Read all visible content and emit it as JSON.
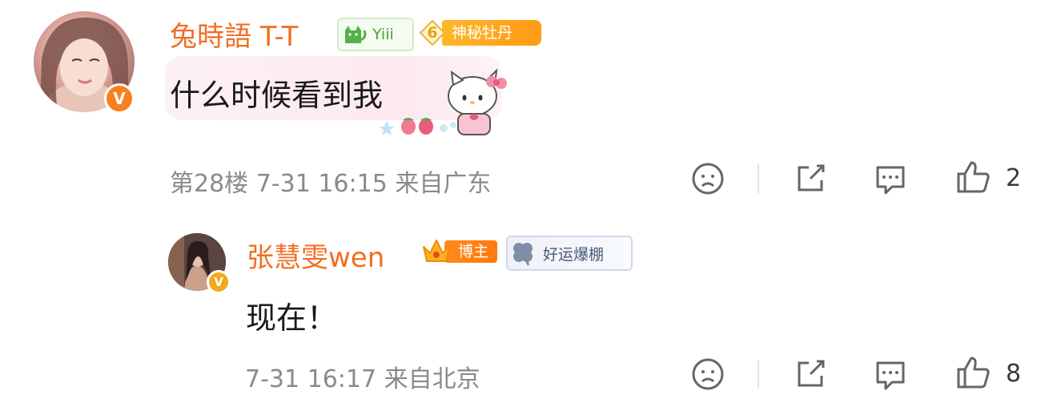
{
  "comment": {
    "username": "兔時語 T-T",
    "badges": {
      "cat_badge": "Yiii",
      "level": "6",
      "level_title": "神秘牡丹"
    },
    "content": "什么时候看到我",
    "meta": "第28楼 7-31 16:15 来自广东",
    "like_count": "2"
  },
  "reply": {
    "username": "张慧雯wen",
    "badges": {
      "role": "博主",
      "fan_title": "好运爆棚"
    },
    "content": "现在！",
    "meta": "7-31 16:17 来自北京",
    "like_count": "8"
  },
  "icons": {
    "verified": "V",
    "actions": [
      "dislike-face-icon",
      "share-icon",
      "reply-comment-icon",
      "like-thumb-icon"
    ]
  },
  "colors": {
    "name": "#f26d22",
    "meta": "#8a8a8a",
    "verified": "#f7811e",
    "badge_orange": "#ff9a14",
    "badge_green": "#4aa13a"
  }
}
